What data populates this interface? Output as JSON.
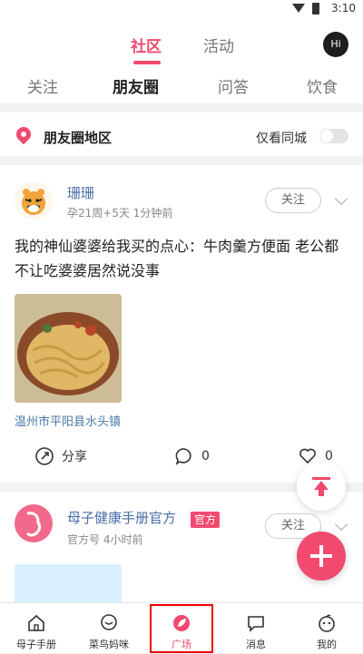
{
  "status": {
    "time": "3:10"
  },
  "header": {
    "tabs": [
      {
        "label": "社区",
        "active": true
      },
      {
        "label": "活动",
        "active": false
      }
    ],
    "avatar_label": "Hi"
  },
  "subtabs": [
    "关注",
    "朋友圈",
    "问答",
    "饮食"
  ],
  "region": {
    "label": "朋友圈地区",
    "city_filter_label": "仅看同城",
    "city_filter_on": false
  },
  "posts": [
    {
      "author": "珊珊",
      "meta": "孕21周+5天   1分钟前",
      "follow_label": "关注",
      "text": "我的神仙婆婆给我买的点心：牛肉羹方便面 老公都不让吃婆婆居然说没事",
      "location": "温州市平阳县水头镇",
      "share_label": "分享",
      "comment_count": "0",
      "like_count": "0"
    },
    {
      "author": "母子健康手册官方",
      "badge": "官方",
      "meta": "官方号   4小时前",
      "follow_label": "关注"
    }
  ],
  "bottom_nav": [
    {
      "label": "母子手册",
      "icon": "home-icon",
      "active": false
    },
    {
      "label": "菜鸟妈咪",
      "icon": "chat-bubble-icon",
      "active": false
    },
    {
      "label": "广场",
      "icon": "leaf-icon",
      "active": true
    },
    {
      "label": "消息",
      "icon": "message-icon",
      "active": false
    },
    {
      "label": "我的",
      "icon": "profile-icon",
      "active": false
    }
  ],
  "colors": {
    "accent": "#f14a6e",
    "link": "#4a6da7",
    "location": "#4a7aa7",
    "background": "#f2f2f2"
  }
}
